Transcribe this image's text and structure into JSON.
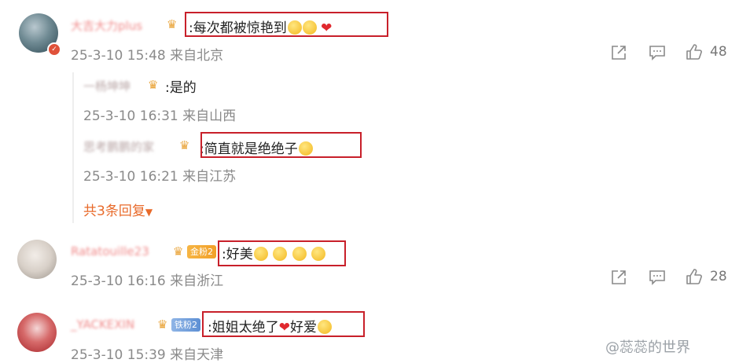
{
  "comments": [
    {
      "username": "大吉大力plus",
      "content": ":每次都被惊艳到",
      "emojis": [
        "😋",
        "🤗",
        "❤"
      ],
      "meta": "25-3-10 15:48 来自北京",
      "likes": "48",
      "replies": [
        {
          "username": "一杨坤坤",
          "content": ":是的",
          "meta": "25-3-10 16:31 来自山西"
        },
        {
          "username": "思考鹏鹏的家",
          "content": ":简直就是绝绝子",
          "emoji": "🤭",
          "meta": "25-3-10 16:21 来自江苏"
        }
      ],
      "more_replies": "共3条回复"
    },
    {
      "username": "Ratatouille23",
      "fan_badge": "金粉2",
      "content": ":好美",
      "emojis": [
        "😍",
        "😍",
        "😍",
        "😍"
      ],
      "meta": "25-3-10 16:16 来自浙江",
      "likes": "28"
    },
    {
      "username": "_YACKEXIN",
      "fan_badge": "铁粉2",
      "content": ":姐姐太绝了",
      "emoji_heart": "❤",
      "content_after": "好爱",
      "emoji_end": "😍",
      "meta": "25-3-10 15:39 来自天津"
    }
  ],
  "watermark": "@蕊蕊的世界",
  "colors": {
    "highlight_box": "#c8202a",
    "more_link": "#e86a2a",
    "meta_text": "#8a8a8a"
  },
  "icons": [
    "share-icon",
    "comment-icon",
    "like-icon",
    "crown-icon",
    "verified-icon"
  ]
}
